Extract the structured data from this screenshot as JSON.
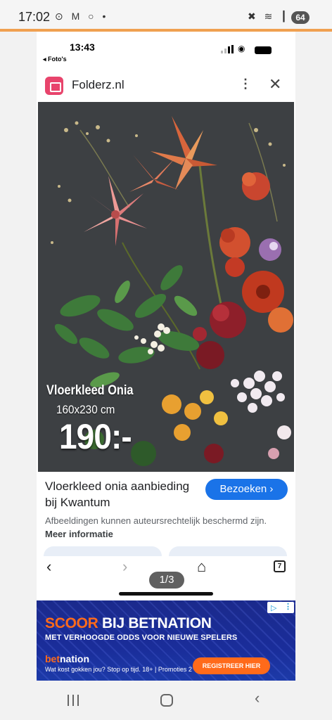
{
  "device_status": {
    "time": "17:02",
    "left_icons": "⊙ M ○ •",
    "right_icons": "✖ ≋ ┃",
    "battery": "64"
  },
  "inner_status": {
    "time": "13:43",
    "back_label": "◂ Foto's"
  },
  "site": {
    "name": "Folderz.nl",
    "menu_icon": "⋮",
    "close_icon": "✕"
  },
  "product": {
    "name": "Vloerkleed Onia",
    "size": "160x230 cm",
    "price": "190:-"
  },
  "result": {
    "title": "Vloerkleed onia aanbieding bij Kwantum",
    "visit_label": "Bezoeken ›",
    "disclaimer": "Afbeeldingen kunnen auteursrechtelijk beschermd zijn.",
    "more_info": "Meer informatie"
  },
  "nav": {
    "back_icon": "‹",
    "forward_icon": "›",
    "home_icon": "⌂",
    "tab_count": "7",
    "page_indicator": "1/3"
  },
  "ad": {
    "headline_accent": "SCOOR",
    "headline_rest": " BIJ BETNATION",
    "subline": "MET VERHOOGDE ODDS VOOR NIEUWE SPELERS",
    "brand_accent": "bet",
    "brand_rest": "nation",
    "fine_print": "Wat kost gokken jou? Stop op tijd. 18+ | Promoties 2",
    "cta": "REGISTREER HIER"
  },
  "colors": {
    "accent": "#1a73e8",
    "ad_orange": "#ff6a1a",
    "ad_blue": "#1b2a8c"
  }
}
